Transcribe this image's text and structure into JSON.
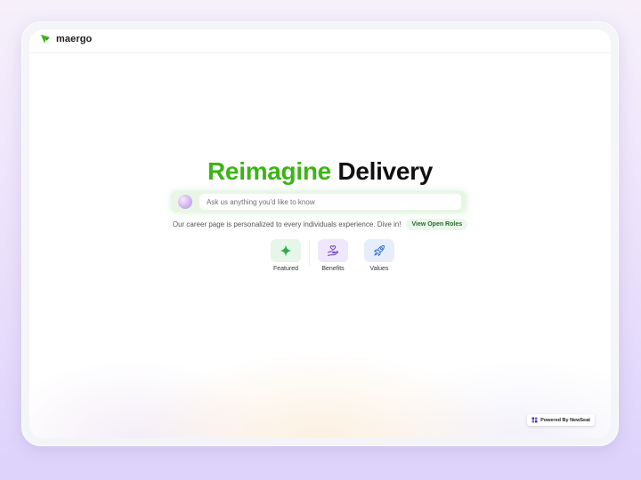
{
  "brand": {
    "name": "maergo",
    "icon": "arrow-icon",
    "color": "#3cb416"
  },
  "hero": {
    "title_accent": "Reimagine",
    "title_rest": "Delivery"
  },
  "ask": {
    "placeholder": "Ask us anything you'd like to know",
    "avatar_icon": "avatar-orb-icon"
  },
  "subtitle": {
    "text": "Our career page is personalized to every individuals experience. Dive in!",
    "roles_button": "View Open Roles"
  },
  "tiles": [
    {
      "label": "Featured",
      "icon": "sparkle-icon",
      "color": "#e6f6e8"
    },
    {
      "label": "Benefits",
      "icon": "hand-heart-icon",
      "color": "#efe7fb"
    },
    {
      "label": "Values",
      "icon": "rocket-icon",
      "color": "#e6eefb"
    }
  ],
  "badge": {
    "text": "Powered By NewSeat",
    "icon": "newseat-logo-icon"
  }
}
